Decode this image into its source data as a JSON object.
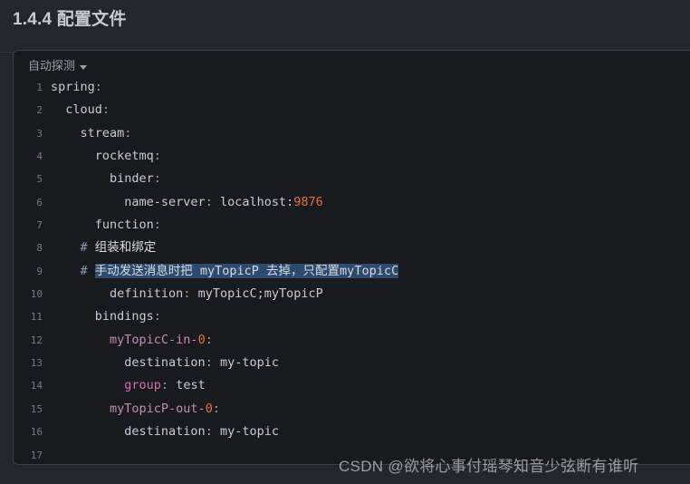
{
  "header": {
    "title": "1.4.4 配置文件"
  },
  "code_panel": {
    "language_label": "自动探测",
    "caret_icon": "chevron-down-icon",
    "lines": [
      {
        "number": "1",
        "segments": [
          {
            "text": "spring",
            "token": "key"
          },
          {
            "text": ":",
            "token": "punct"
          }
        ]
      },
      {
        "number": "2",
        "segments": [
          {
            "text": "  cloud",
            "token": "key"
          },
          {
            "text": ":",
            "token": "punct"
          }
        ]
      },
      {
        "number": "3",
        "segments": [
          {
            "text": "    stream",
            "token": "key"
          },
          {
            "text": ":",
            "token": "punct"
          }
        ]
      },
      {
        "number": "4",
        "segments": [
          {
            "text": "      rocketmq",
            "token": "key"
          },
          {
            "text": ":",
            "token": "punct"
          }
        ]
      },
      {
        "number": "5",
        "segments": [
          {
            "text": "        binder",
            "token": "key"
          },
          {
            "text": ":",
            "token": "punct"
          }
        ]
      },
      {
        "number": "6",
        "segments": [
          {
            "text": "          name-server",
            "token": "key"
          },
          {
            "text": ": ",
            "token": "punct"
          },
          {
            "text": "localhost:",
            "token": "val"
          },
          {
            "text": "9876",
            "token": "num"
          }
        ]
      },
      {
        "number": "7",
        "segments": [
          {
            "text": "      function",
            "token": "key"
          },
          {
            "text": ":",
            "token": "punct"
          }
        ]
      },
      {
        "number": "8",
        "segments": [
          {
            "text": "    # ",
            "token": "hash"
          },
          {
            "text": "组装和绑定",
            "token": "cmt"
          }
        ]
      },
      {
        "number": "9",
        "segments": [
          {
            "text": "    # ",
            "token": "hash"
          },
          {
            "text": "手动发送消息时把 myTopicP 去掉，只配置myTopicC",
            "token": "cmt",
            "selected": true
          }
        ]
      },
      {
        "number": "10",
        "segments": [
          {
            "text": "        definition",
            "token": "key"
          },
          {
            "text": ": ",
            "token": "punct"
          },
          {
            "text": "myTopicC;myTopicP",
            "token": "val"
          }
        ]
      },
      {
        "number": "11",
        "segments": [
          {
            "text": "      bindings",
            "token": "key"
          },
          {
            "text": ":",
            "token": "punct"
          }
        ]
      },
      {
        "number": "12",
        "segments": [
          {
            "text": "        myTopicC-in-",
            "token": "bind"
          },
          {
            "text": "0",
            "token": "num"
          },
          {
            "text": ":",
            "token": "punct"
          }
        ]
      },
      {
        "number": "13",
        "segments": [
          {
            "text": "          destination",
            "token": "key"
          },
          {
            "text": ": ",
            "token": "punct"
          },
          {
            "text": "my-topic",
            "token": "val"
          }
        ]
      },
      {
        "number": "14",
        "segments": [
          {
            "text": "          group",
            "token": "grp"
          },
          {
            "text": ": ",
            "token": "punct"
          },
          {
            "text": "test",
            "token": "val"
          }
        ]
      },
      {
        "number": "15",
        "segments": [
          {
            "text": "        myTopicP-out-",
            "token": "bind"
          },
          {
            "text": "0",
            "token": "num"
          },
          {
            "text": ":",
            "token": "punct"
          }
        ]
      },
      {
        "number": "16",
        "segments": [
          {
            "text": "          destination",
            "token": "key"
          },
          {
            "text": ": ",
            "token": "punct"
          },
          {
            "text": "my-topic",
            "token": "val"
          }
        ]
      },
      {
        "number": "17",
        "segments": []
      }
    ]
  },
  "watermark": {
    "text": "CSDN @欲将心事付瑶琴知音少弦断有谁听"
  },
  "colors": {
    "page_background": "#23262b",
    "code_background": "#181a1d",
    "card_border": "#3a3f45",
    "title_text": "#c8ccd2",
    "gutter_text": "#737b85",
    "code_text": "#c8ccd4",
    "number_token": "#e8703a",
    "binding_token": "#c38fb1",
    "group_token": "#d26fb0",
    "selection": "#2d4a6e"
  }
}
